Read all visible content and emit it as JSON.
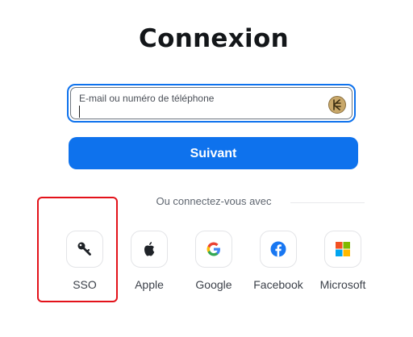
{
  "heading": "Connexion",
  "login_field": {
    "label": "E-mail ou numéro de téléphone",
    "value": "",
    "icon": "password-manager-icon"
  },
  "next_button": "Suivant",
  "divider_text": "Ou connectez-vous avec",
  "social_logins": [
    {
      "label": "SSO",
      "icon": "key-icon"
    },
    {
      "label": "Apple",
      "icon": "apple-icon"
    },
    {
      "label": "Google",
      "icon": "google-icon"
    },
    {
      "label": "Facebook",
      "icon": "facebook-icon"
    },
    {
      "label": "Microsoft",
      "icon": "microsoft-icon"
    }
  ],
  "colors": {
    "accent": "#0e72ed",
    "highlight": "#e3121a",
    "facebook": "#1877f2",
    "microsoft": [
      "#f25022",
      "#7fba00",
      "#00a4ef",
      "#ffb900"
    ]
  }
}
